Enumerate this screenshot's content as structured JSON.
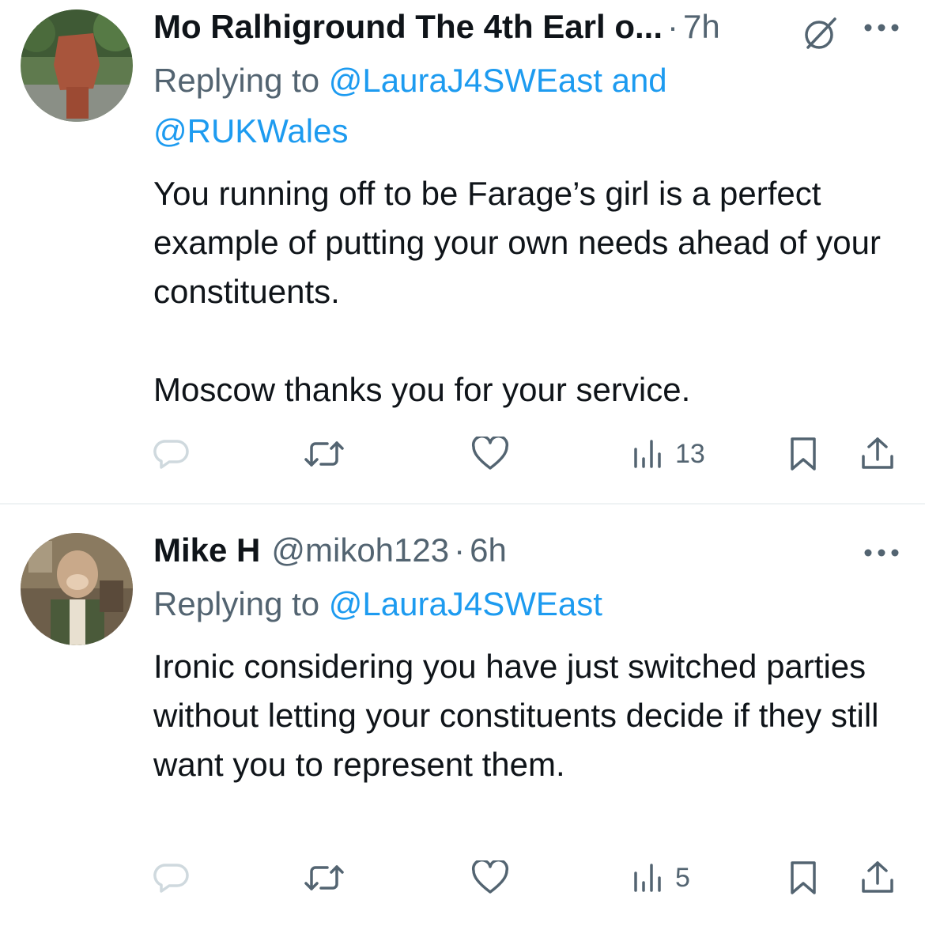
{
  "tweets": [
    {
      "name": "Mo Ralhiground The 4th Earl o...",
      "handle": "",
      "separator": "·",
      "time": "7h",
      "replying_prefix": "Replying to",
      "mentions": [
        "@LauraJ4SWEast",
        "@RUKWales"
      ],
      "mention_joiner": "and",
      "body": [
        "You running off to be Farage’s girl is a perfect example of putting your own needs ahead of your constituents.",
        "Moscow thanks you for your service."
      ],
      "actions": {
        "reply_count": "",
        "retweet_count": "",
        "like_count": "",
        "views_count": "13"
      },
      "icons": [
        "grok-icon",
        "more-icon",
        "reply-icon",
        "retweet-icon",
        "heart-icon",
        "views-icon",
        "bookmark-icon",
        "share-icon"
      ]
    },
    {
      "name": "Mike H",
      "handle": "@mikoh123",
      "separator": "·",
      "time": "6h",
      "replying_prefix": "Replying to",
      "mentions": [
        "@LauraJ4SWEast"
      ],
      "body": [
        "Ironic considering you have just switched parties without letting your constituents decide if they still want you to represent them."
      ],
      "actions": {
        "reply_count": "",
        "retweet_count": "",
        "like_count": "",
        "views_count": "5"
      },
      "icons": [
        "more-icon",
        "reply-icon",
        "retweet-icon",
        "heart-icon",
        "views-icon",
        "bookmark-icon",
        "share-icon"
      ]
    }
  ],
  "colors": {
    "text": "#0f1419",
    "secondary": "#536471",
    "link": "#1d9bf0",
    "divider": "#eff3f4",
    "reply_icon": "#cfd9de"
  }
}
